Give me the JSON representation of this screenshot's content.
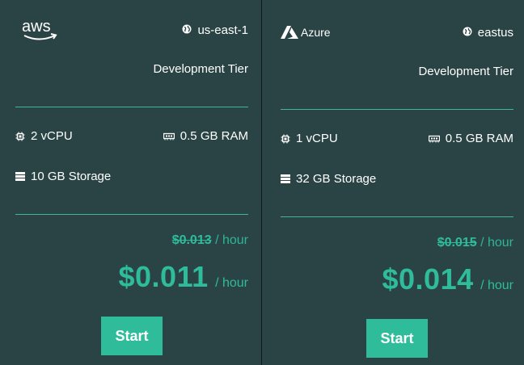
{
  "cards": [
    {
      "provider_logo": "aws",
      "logo_text": "aws",
      "region": "us-east-1",
      "tier": "Development Tier",
      "cpu": "2 vCPU",
      "ram": "0.5 GB RAM",
      "storage": "10 GB Storage",
      "old_price": "$0.013",
      "old_price_unit": "/ hour",
      "price": "$0.011",
      "price_unit": "/ hour",
      "button_label": "Start"
    },
    {
      "provider_logo": "azure",
      "logo_text": "Azure",
      "region": "eastus",
      "tier": "Development Tier",
      "cpu": "1 vCPU",
      "ram": "0.5 GB RAM",
      "storage": "32 GB Storage",
      "old_price": "$0.015",
      "old_price_unit": "/ hour",
      "price": "$0.014",
      "price_unit": "/ hour",
      "button_label": "Start"
    }
  ],
  "icons": {
    "region": "globe-icon",
    "cpu": "cpu-chip-icon",
    "ram": "memory-icon",
    "storage": "storage-icon"
  },
  "colors": {
    "background": "#2a4445",
    "accent": "#2fbc9b",
    "text": "#ffffff"
  }
}
